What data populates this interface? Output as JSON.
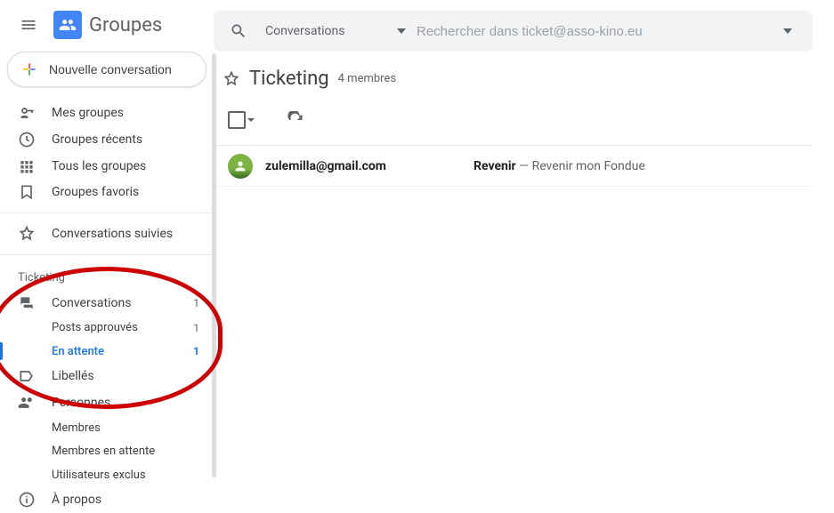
{
  "appName": "Groupes",
  "compose": "Nouvelle conversation",
  "nav": {
    "myGroups": "Mes groupes",
    "recentGroups": "Groupes récents",
    "allGroups": "Tous les groupes",
    "favGroups": "Groupes favoris",
    "starred": "Conversations suivies"
  },
  "section": "Ticketing",
  "groupNav": {
    "conversations": {
      "label": "Conversations",
      "count": "1"
    },
    "approved": {
      "label": "Posts approuvés",
      "count": "1"
    },
    "pending": {
      "label": "En attente",
      "count": "1"
    },
    "labels": "Libellés",
    "people": "Personnes",
    "members": "Membres",
    "pendingMembers": "Membres en attente",
    "banned": "Utilisateurs exclus",
    "about": "À propos"
  },
  "search": {
    "scope": "Conversations",
    "placeholder": "Rechercher dans ticket@asso-kino.eu"
  },
  "group": {
    "title": "Ticketing",
    "members": "4 membres"
  },
  "thread": {
    "sender": "zulemilla@gmail.com",
    "subject": "Revenir",
    "snippet": " — Revenir mon Fondue"
  }
}
